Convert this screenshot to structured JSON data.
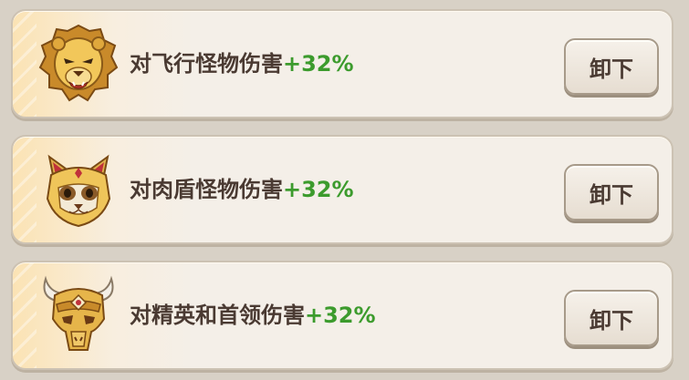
{
  "items": [
    {
      "text": "对飞行怪物伤害",
      "bonus": "+32%",
      "icon": "lion-head-icon",
      "button": "卸下"
    },
    {
      "text": "对肉盾怪物伤害",
      "bonus": "+32%",
      "icon": "cat-mask-icon",
      "button": "卸下"
    },
    {
      "text": "对精英和首领伤害",
      "bonus": "+32%",
      "icon": "horned-skull-icon",
      "button": "卸下"
    }
  ],
  "colors": {
    "bonus": "#3c9b2d",
    "text": "#4a3a32",
    "gold": "#d9a63b"
  }
}
